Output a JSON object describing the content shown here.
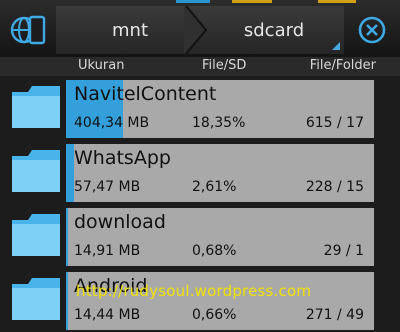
{
  "breadcrumb": {
    "items": [
      "mnt",
      "sdcard"
    ]
  },
  "columns": {
    "size": "Ukuran",
    "percent": "File/SD",
    "count": "File/Folder"
  },
  "rows": [
    {
      "name": "NavitelContent",
      "size": "404,34 MB",
      "percent": "18,35%",
      "count": "615 / 17",
      "usage": 0.1835
    },
    {
      "name": "WhatsApp",
      "size": "57,47 MB",
      "percent": "2,61%",
      "count": "228 / 15",
      "usage": 0.0261
    },
    {
      "name": "download",
      "size": "14,91 MB",
      "percent": "0,68%",
      "count": "29 / 1",
      "usage": 0.0068
    },
    {
      "name": "Android",
      "size": "14,44 MB",
      "percent": "0,66%",
      "count": "271 / 49",
      "usage": 0.0066
    }
  ],
  "watermark": "http://rudysoul.wordpress.com",
  "colors": {
    "accent": "#33a0dc",
    "card": "#a9a9a9",
    "watermark": "#f1e300"
  },
  "icons": {
    "device": "device-storage-icon",
    "close": "close-circle-icon",
    "folder": "folder-icon"
  }
}
